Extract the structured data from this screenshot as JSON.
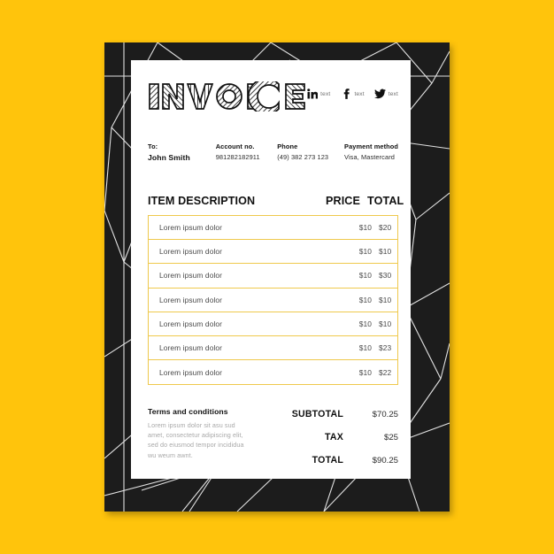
{
  "theme": {
    "background_yellow": "#FFC40C",
    "frame_black": "#1c1c1c",
    "sheet_white": "#FFFFFF",
    "row_border_gold": "#EFC94C",
    "text_dark": "#111111",
    "text_muted": "#a8a8a8"
  },
  "header": {
    "title": "INVOICE",
    "social": [
      {
        "icon": "linkedin-icon",
        "label": "text"
      },
      {
        "icon": "facebook-icon",
        "label": "text"
      },
      {
        "icon": "twitter-icon",
        "label": "text"
      }
    ]
  },
  "meta": {
    "to_label": "To:",
    "to_value": "John Smith",
    "account_label": "Account no.",
    "account_value": "981282182911",
    "phone_label": "Phone",
    "phone_value": "(49) 382 273 123",
    "payment_label": "Payment method",
    "payment_value": "Visa, Mastercard"
  },
  "table": {
    "columns": {
      "description": "ITEM DESCRIPTION",
      "price": "PRICE",
      "total": "TOTAL"
    },
    "rows": [
      {
        "description": "Lorem ipsum dolor",
        "price": "$10",
        "total": "$20"
      },
      {
        "description": "Lorem ipsum dolor",
        "price": "$10",
        "total": "$10"
      },
      {
        "description": "Lorem ipsum dolor",
        "price": "$10",
        "total": "$30"
      },
      {
        "description": "Lorem ipsum dolor",
        "price": "$10",
        "total": "$10"
      },
      {
        "description": "Lorem ipsum dolor",
        "price": "$10",
        "total": "$10"
      },
      {
        "description": "Lorem ipsum dolor",
        "price": "$10",
        "total": "$23"
      },
      {
        "description": "Lorem ipsum dolor",
        "price": "$10",
        "total": "$22"
      }
    ]
  },
  "terms": {
    "title": "Terms and conditions",
    "body": "Lorem ipsum dolor sit asu sud amet, consectetur adipiscing elit, sed do eiusmod tempor incididua  wu weum awnt."
  },
  "totals": {
    "subtotal_label": "SUBTOTAL",
    "subtotal_value": "$70.25",
    "tax_label": "TAX",
    "tax_value": "$25",
    "total_label": "TOTAL",
    "total_value": "$90.25"
  }
}
